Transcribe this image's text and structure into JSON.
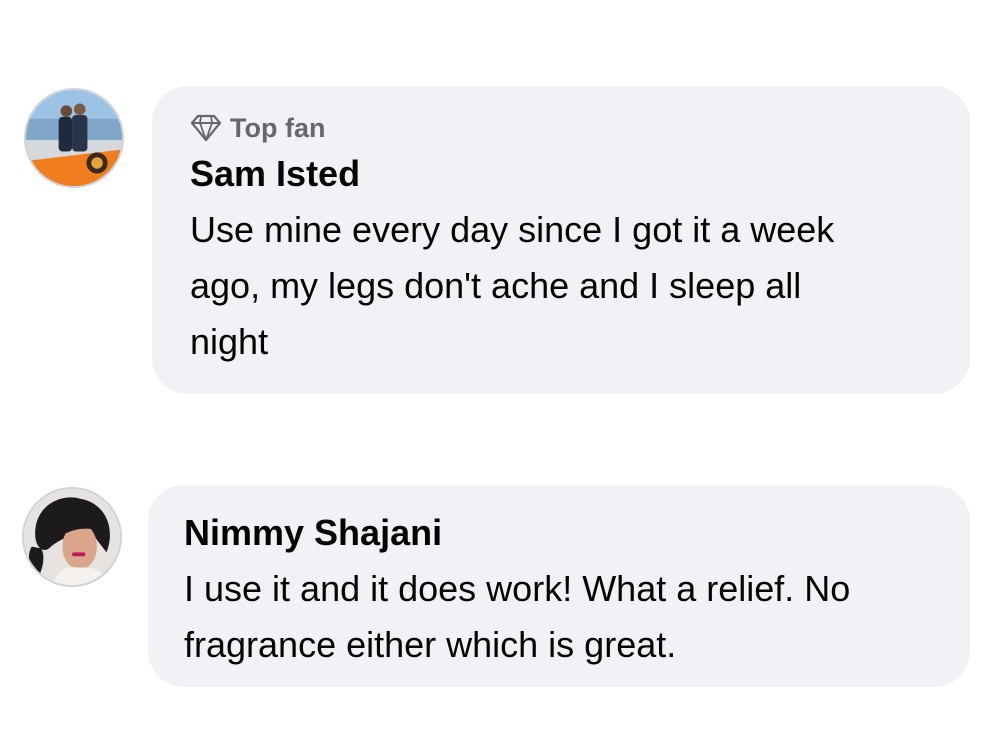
{
  "comments": [
    {
      "badge": "Top fan",
      "badge_icon": "diamond-icon",
      "author": "Sam Isted",
      "text": "Use mine every day since I got it a week\nago, my legs don't ache and I sleep all\nnight",
      "avatar": "avatar-photo"
    },
    {
      "author": "Nimmy Shajani",
      "text": "I use it and it does work! What a relief. No\nfragrance either which is great.",
      "avatar": "avatar-photo"
    }
  ],
  "colors": {
    "bubble_background": "#f0f2f5",
    "author_text": "#050505",
    "badge_text": "#65676b"
  }
}
